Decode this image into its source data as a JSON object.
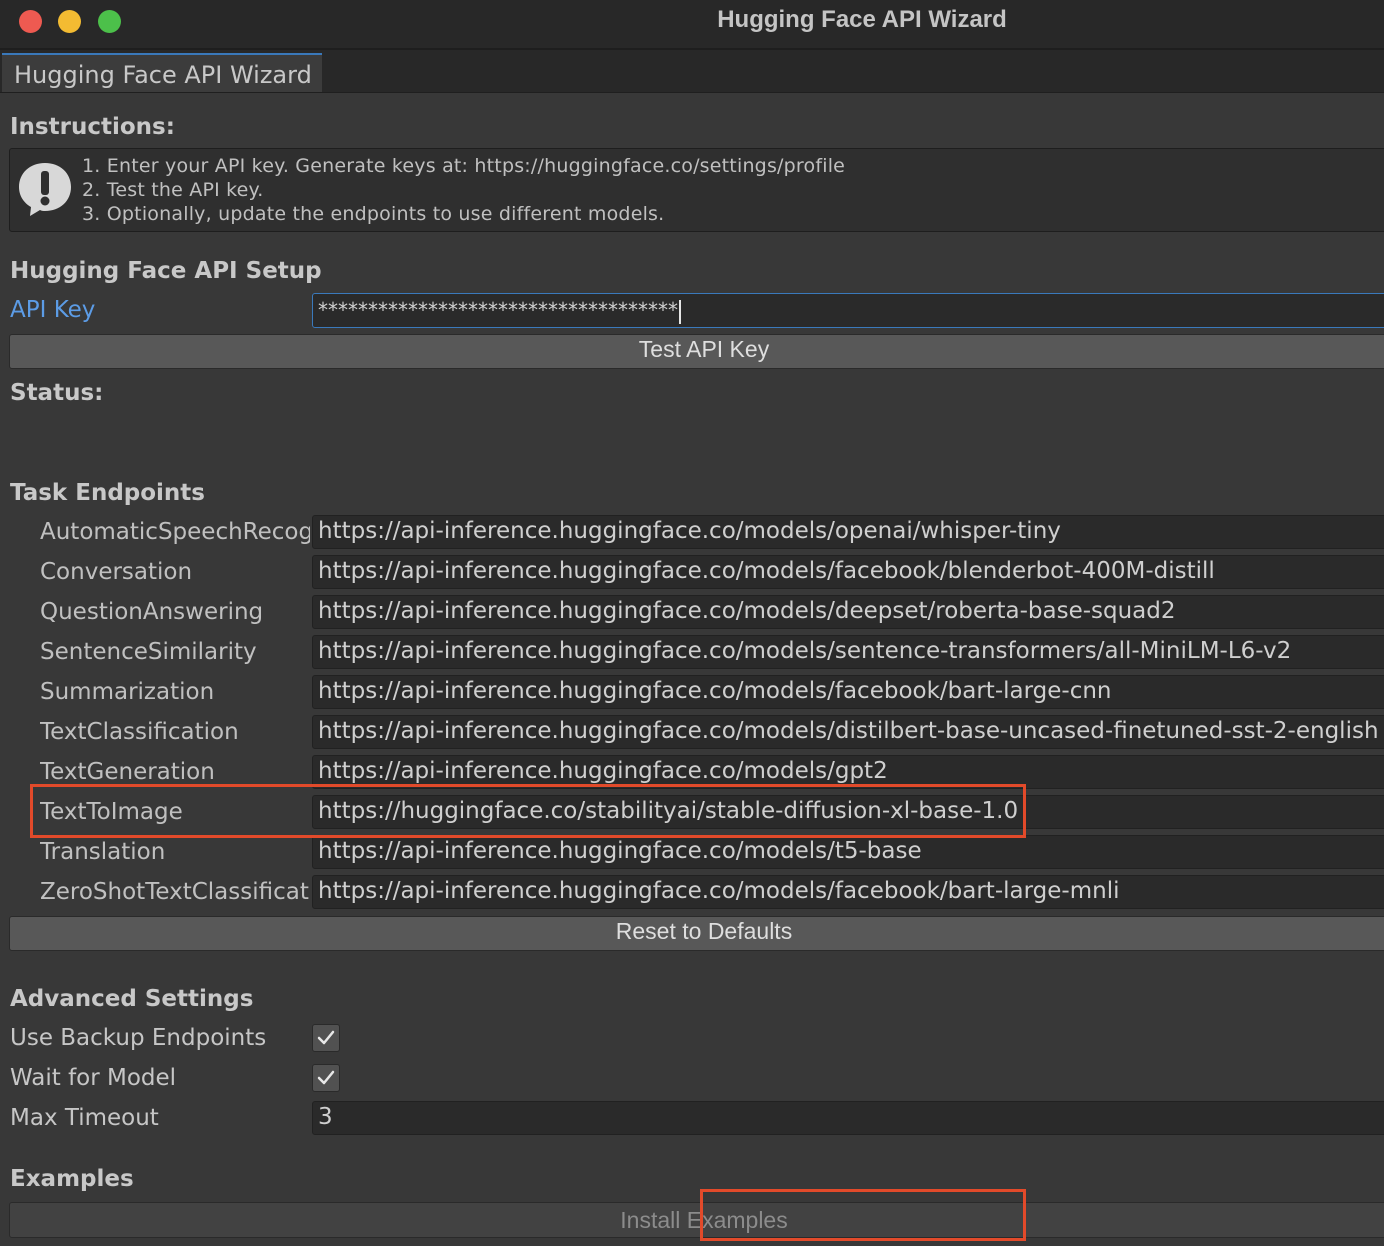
{
  "window": {
    "title": "Hugging Face API Wizard",
    "traffic_lights": {
      "close": "#ee5a51",
      "minimize": "#f3bb32",
      "maximize": "#4cc04a"
    }
  },
  "tab": {
    "label": "Hugging Face API Wizard"
  },
  "instructions": {
    "heading": "Instructions:",
    "icon": "warning-icon",
    "lines": [
      "1. Enter your API key. Generate keys at: https://huggingface.co/settings/profile",
      "2. Test the API key.",
      "3. Optionally, update the endpoints to use different models."
    ]
  },
  "setup": {
    "heading": "Hugging Face API Setup",
    "api_key_label": "API Key",
    "api_key_value": "************************************",
    "test_button": "Test API Key",
    "status_label": "Status:",
    "status_value": ""
  },
  "endpoints": {
    "heading": "Task Endpoints",
    "items": [
      {
        "label": "AutomaticSpeechRecognition",
        "url": "https://api-inference.huggingface.co/models/openai/whisper-tiny"
      },
      {
        "label": "Conversation",
        "url": "https://api-inference.huggingface.co/models/facebook/blenderbot-400M-distill"
      },
      {
        "label": "QuestionAnswering",
        "url": "https://api-inference.huggingface.co/models/deepset/roberta-base-squad2"
      },
      {
        "label": "SentenceSimilarity",
        "url": "https://api-inference.huggingface.co/models/sentence-transformers/all-MiniLM-L6-v2"
      },
      {
        "label": "Summarization",
        "url": "https://api-inference.huggingface.co/models/facebook/bart-large-cnn"
      },
      {
        "label": "TextClassification",
        "url": "https://api-inference.huggingface.co/models/distilbert-base-uncased-finetuned-sst-2-english"
      },
      {
        "label": "TextGeneration",
        "url": "https://api-inference.huggingface.co/models/gpt2"
      },
      {
        "label": "TextToImage",
        "url": "https://huggingface.co/stabilityai/stable-diffusion-xl-base-1.0"
      },
      {
        "label": "Translation",
        "url": "https://api-inference.huggingface.co/models/t5-base"
      },
      {
        "label": "ZeroShotTextClassification",
        "url": "https://api-inference.huggingface.co/models/facebook/bart-large-mnli"
      }
    ],
    "reset_button": "Reset to Defaults"
  },
  "advanced": {
    "heading": "Advanced Settings",
    "use_backup_label": "Use Backup Endpoints",
    "use_backup_checked": true,
    "wait_label": "Wait for Model",
    "wait_checked": true,
    "timeout_label": "Max Timeout",
    "timeout_value": "3"
  },
  "examples": {
    "heading": "Examples",
    "install_button": "Install Examples"
  },
  "colors": {
    "highlight": "#e24a2a",
    "focus": "#3a79bb",
    "label_active": "#5c9ce6"
  }
}
